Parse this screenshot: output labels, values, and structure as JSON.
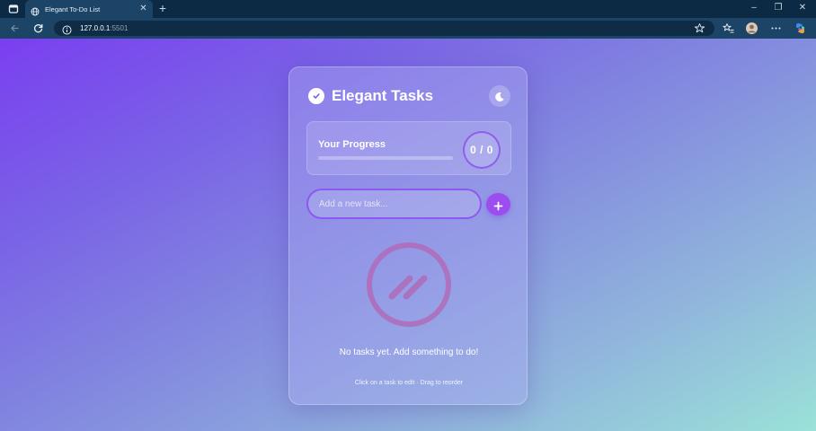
{
  "browser": {
    "tab_title": "Elegant To-Do List",
    "url_host": "127.0.0.1",
    "url_port": ":5501",
    "icons": {
      "tab_overview": "tab-overview-icon",
      "globe": "globe-icon",
      "close": "close-icon",
      "new_tab": "plus-icon",
      "back": "arrow-left-icon",
      "reload": "reload-icon",
      "info": "info-icon",
      "favorite": "star-icon",
      "favorites_list": "favorites-icon",
      "profile": "avatar",
      "more": "more-icon",
      "copilot": "copilot-icon"
    },
    "window_controls": {
      "minimize": "–",
      "restore": "❐",
      "close": "✕"
    }
  },
  "app": {
    "title": "Elegant Tasks",
    "progress": {
      "label": "Your Progress",
      "count": "0 / 0",
      "completed": 0,
      "total": 0,
      "fraction": 0
    },
    "input": {
      "placeholder": "Add a new task...",
      "value": ""
    },
    "empty_message": "No tasks yet. Add something to do!",
    "hint": "Click on a task to edit · Drag to reorder",
    "colors": {
      "accent": "#9b4df0",
      "gradient_start": "#7a3ff0",
      "gradient_end": "#9ae2d8",
      "empty_icon": "#b06bb8"
    }
  }
}
